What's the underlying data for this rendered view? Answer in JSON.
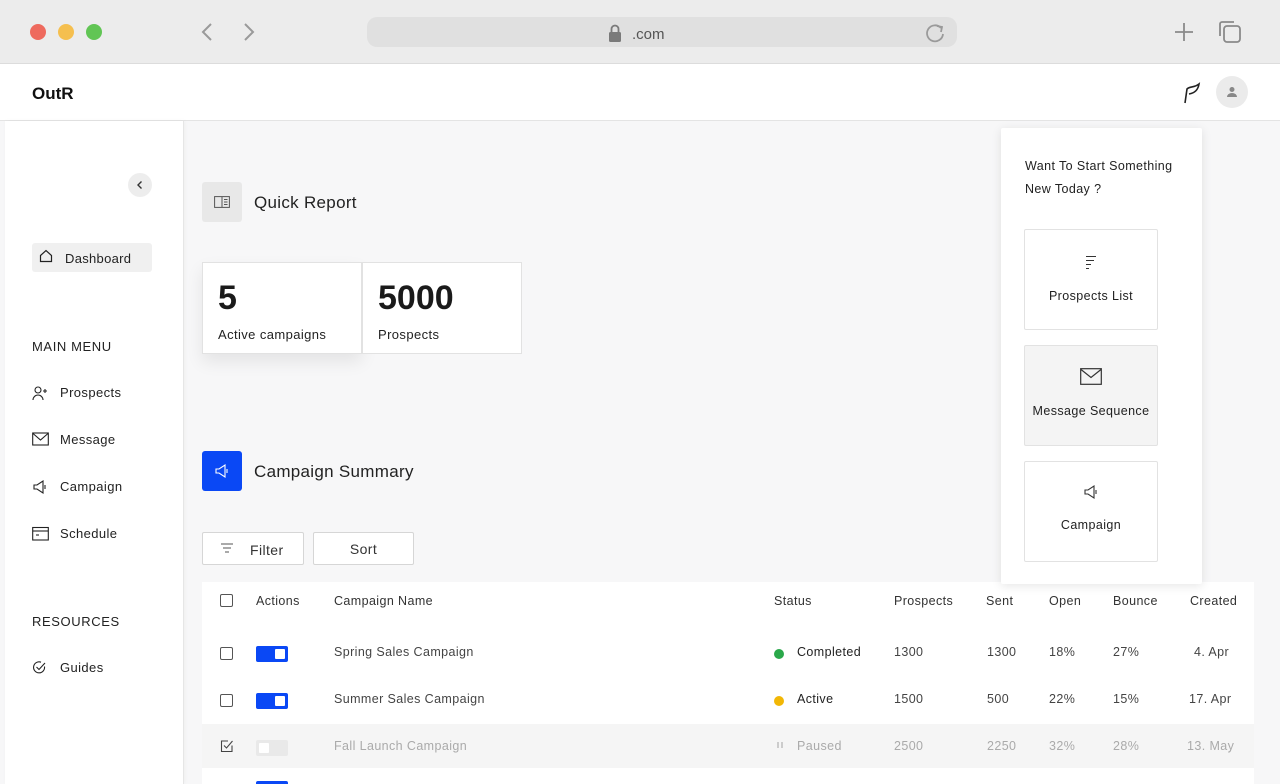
{
  "browser": {
    "address": ".com"
  },
  "app": {
    "brand": "OutR"
  },
  "sidebar": {
    "dashboard_label": "Dashboard",
    "main_menu_title": "MAIN MENU",
    "main_menu": [
      {
        "label": "Prospects",
        "icon": "add-user-icon"
      },
      {
        "label": "Message",
        "icon": "envelope-icon"
      },
      {
        "label": "Campaign",
        "icon": "megaphone-icon"
      },
      {
        "label": "Schedule",
        "icon": "calendar-icon"
      }
    ],
    "resources_title": "RESOURCES",
    "resources": [
      {
        "label": "Guides",
        "icon": "check-circle-icon"
      }
    ]
  },
  "quick_report": {
    "title": "Quick Report",
    "cards": [
      {
        "value": "5",
        "caption": "Active campaigns"
      },
      {
        "value": "5000",
        "caption": "Prospects"
      }
    ]
  },
  "campaign_summary": {
    "title": "Campaign Summary",
    "filter_label": "Filter",
    "sort_label": "Sort",
    "columns": [
      "Actions",
      "Campaign Name",
      "Status",
      "Prospects",
      "Sent",
      "Open",
      "Bounce",
      "Created"
    ],
    "rows": [
      {
        "name": "Spring Sales Campaign",
        "status": "Completed",
        "status_color": "#2aa84a",
        "prospects": "1300",
        "sent": "1300",
        "open": "18%",
        "bounce": "27%",
        "created": "4. Apr",
        "enabled": true,
        "checked": false
      },
      {
        "name": "Summer Sales Campaign",
        "status": "Active",
        "status_color": "#f2b705",
        "prospects": "1500",
        "sent": "500",
        "open": "22%",
        "bounce": "15%",
        "created": "17. Apr",
        "enabled": true,
        "checked": false
      },
      {
        "name": "Fall Launch Campaign",
        "status": "Paused",
        "status_color": "#bbbbbb",
        "prospects": "2500",
        "sent": "2250",
        "open": "32%",
        "bounce": "28%",
        "created": "13. May",
        "enabled": false,
        "checked": true
      }
    ]
  },
  "popover": {
    "title": "Want To Start Something New Today ?",
    "cards": [
      {
        "label": "Prospects List",
        "icon": "list-lines-icon"
      },
      {
        "label": "Message Sequence",
        "icon": "envelope-icon"
      },
      {
        "label": "Campaign",
        "icon": "megaphone-icon"
      }
    ]
  },
  "colors": {
    "accent": "#0a48f5",
    "completed": "#2aa84a",
    "active": "#f2b705"
  }
}
